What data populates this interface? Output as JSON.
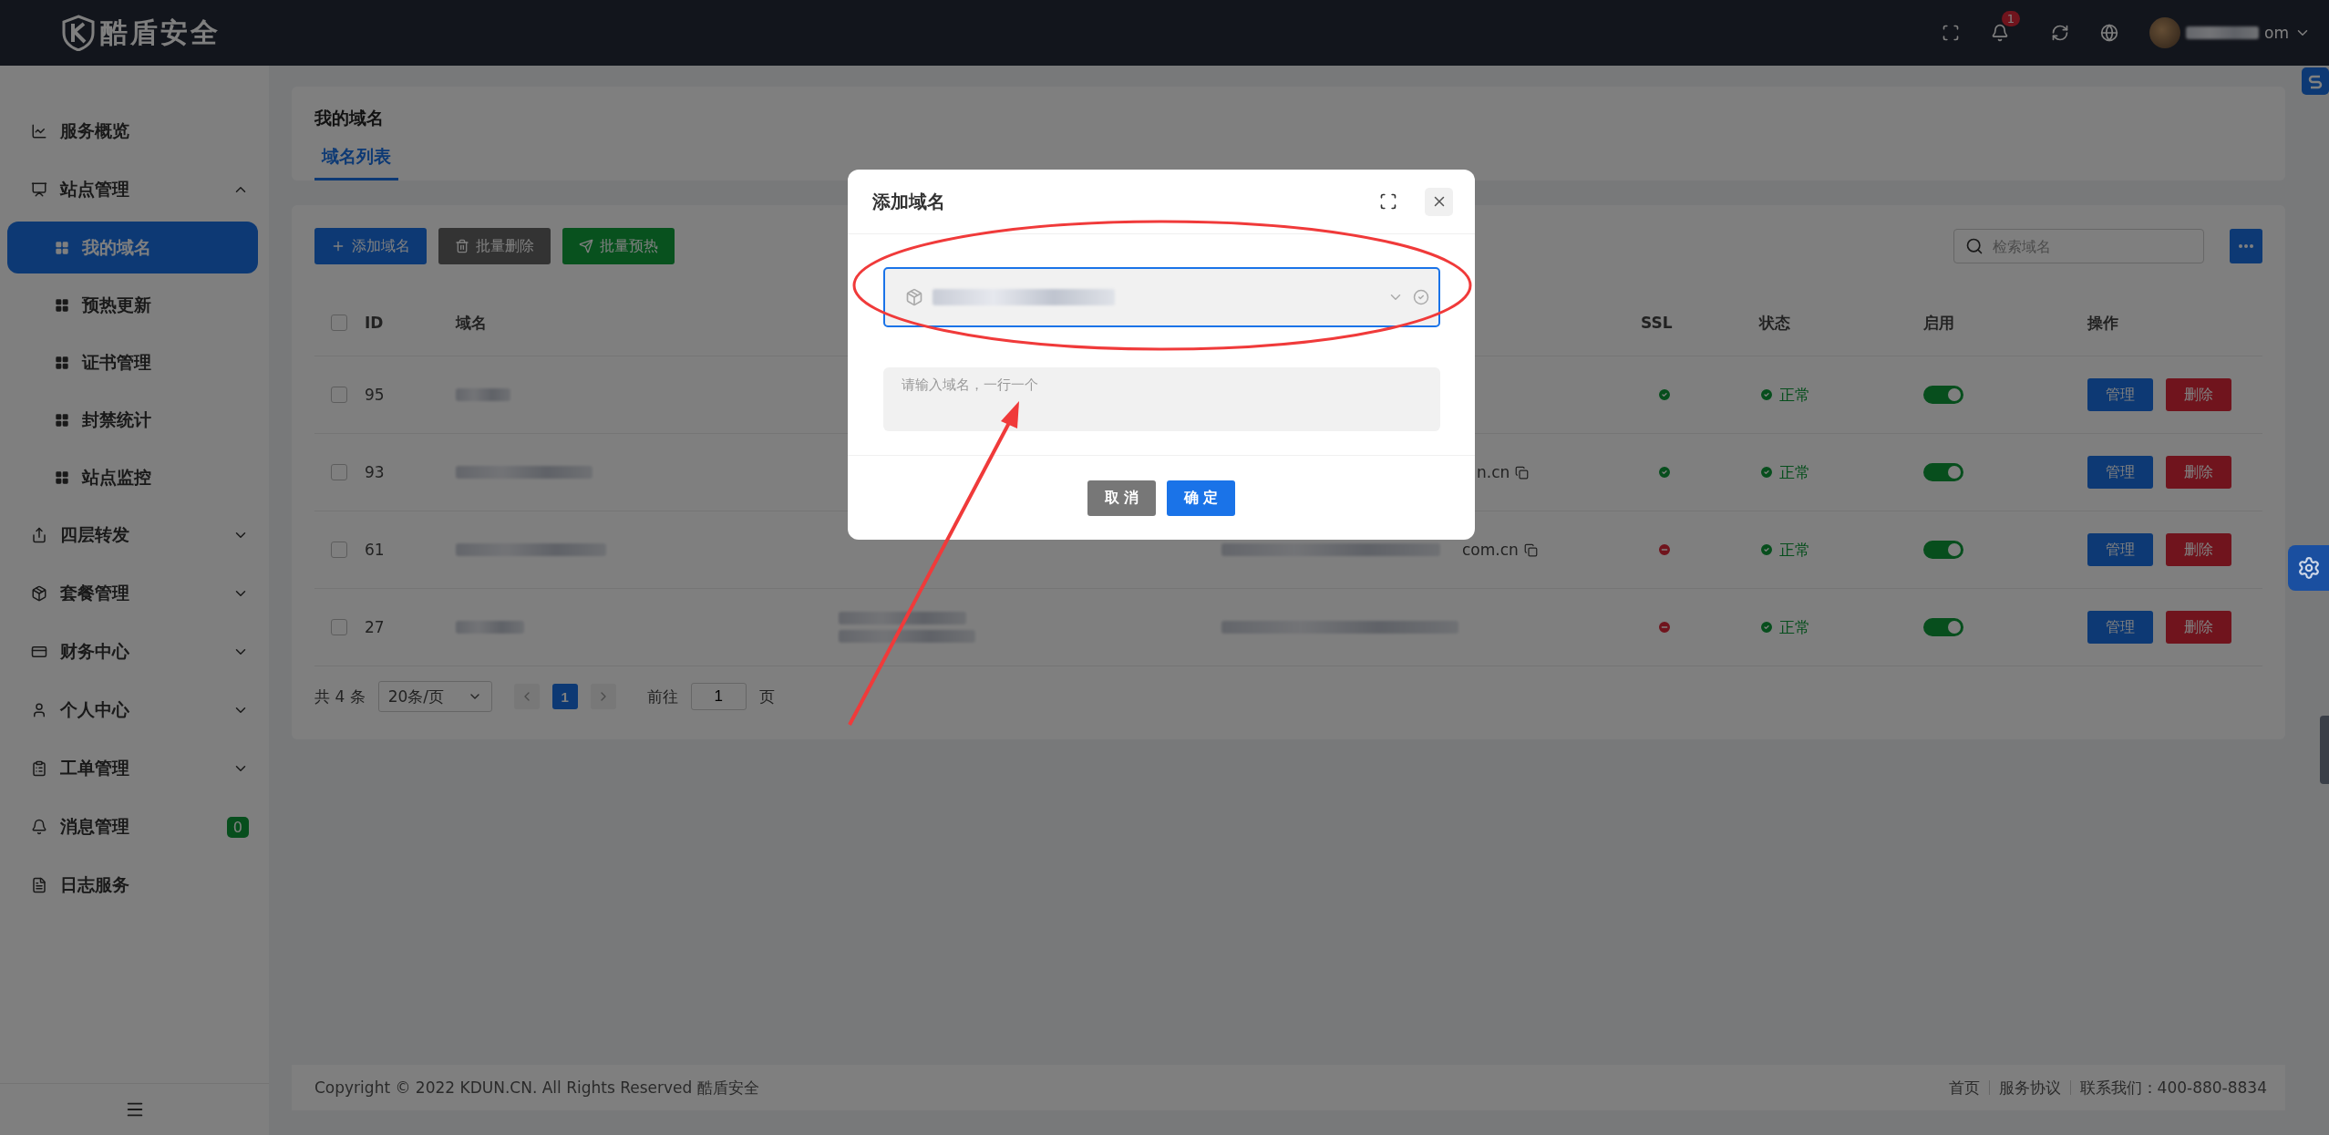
{
  "topbar": {
    "logo": "酷盾安全",
    "notifications": "1",
    "username": "om"
  },
  "sidebar": {
    "items": [
      {
        "label": "服务概览",
        "kind": "link",
        "selected": false
      },
      {
        "label": "站点管理",
        "kind": "group",
        "expanded": true,
        "selected": false,
        "children": [
          {
            "label": "我的域名",
            "selected": true
          },
          {
            "label": "预热更新",
            "selected": false
          },
          {
            "label": "证书管理",
            "selected": false
          },
          {
            "label": "封禁统计",
            "selected": false
          },
          {
            "label": "站点监控",
            "selected": false
          }
        ]
      },
      {
        "label": "四层转发",
        "kind": "group",
        "expanded": false,
        "selected": false
      },
      {
        "label": "套餐管理",
        "kind": "group",
        "expanded": false,
        "selected": false
      },
      {
        "label": "财务中心",
        "kind": "group",
        "expanded": false,
        "selected": false
      },
      {
        "label": "个人中心",
        "kind": "group",
        "expanded": false,
        "selected": false
      },
      {
        "label": "工单管理",
        "kind": "group",
        "expanded": false,
        "selected": false
      },
      {
        "label": "消息管理",
        "kind": "link",
        "badge": "0",
        "selected": false
      },
      {
        "label": "日志服务",
        "kind": "link",
        "selected": false
      }
    ]
  },
  "page": {
    "title": "我的域名",
    "tabs": [
      {
        "label": "域名列表",
        "selected": true
      }
    ]
  },
  "toolbar": {
    "buttons": [
      {
        "label": "添加域名",
        "kind": "primary"
      },
      {
        "label": "批量删除",
        "kind": "neutral"
      },
      {
        "label": "批量预热",
        "kind": "success"
      }
    ],
    "search": {
      "placeholder": "检索域名"
    }
  },
  "table": {
    "select_all": {
      "checked": false
    },
    "columns": [
      "ID",
      "域名",
      "SSL",
      "状态",
      "启用",
      "操作"
    ],
    "rows": [
      {
        "checked": false,
        "id": "95",
        "ssl": true,
        "status": "正常",
        "enabled": true,
        "actions": [
          "管理",
          "删除"
        ]
      },
      {
        "checked": false,
        "id": "93",
        "column_4": "n.cn",
        "ssl": true,
        "status": "正常",
        "enabled": true,
        "actions": [
          "管理",
          "删除"
        ]
      },
      {
        "checked": false,
        "id": "61",
        "column_4": "com.cn",
        "ssl": false,
        "status": "正常",
        "enabled": true,
        "actions": [
          "管理",
          "删除"
        ]
      },
      {
        "checked": false,
        "id": "27",
        "ssl": false,
        "status": "正常",
        "enabled": true,
        "actions": [
          "管理",
          "删除"
        ]
      }
    ]
  },
  "pagination": {
    "total": "共 4 条",
    "page_size": "20条/页",
    "pages": [
      {
        "label": "1",
        "selected": true
      }
    ],
    "goto_label": "前往",
    "goto_value": "1",
    "goto_suffix": "页"
  },
  "footer": {
    "copyright": "Copyright © 2022 KDUN.CN. All Rights Reserved 酷盾安全",
    "links": [
      "首页",
      "服务协议",
      "联系我们：400-880-8834"
    ]
  },
  "dialog": {
    "title": "添加域名",
    "textarea": {
      "placeholder": "请输入域名，一行一个"
    },
    "buttons": [
      {
        "label": "取 消",
        "kind": "cancel"
      },
      {
        "label": "确 定",
        "kind": "confirm"
      }
    ]
  }
}
